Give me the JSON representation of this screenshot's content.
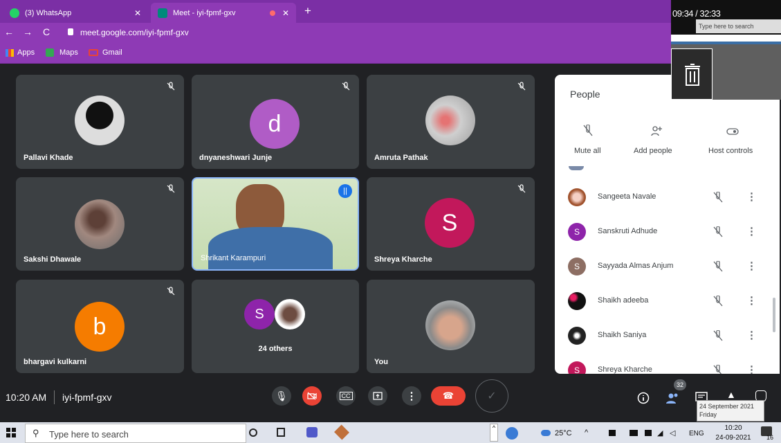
{
  "browser": {
    "tabs": [
      {
        "title": "(3) WhatsApp"
      },
      {
        "title": "Meet - iyi-fpmf-gxv"
      }
    ],
    "url": "meet.google.com/iyi-fpmf-gxv",
    "bookmarks": [
      "Apps",
      "Maps",
      "Gmail"
    ]
  },
  "video_overlay": {
    "time": "09:34 / 32:33",
    "search_placeholder": "Type here to search"
  },
  "tiles": [
    {
      "name": "Pallavi Khade"
    },
    {
      "name": "dnyaneshwari Junje",
      "initial": "d",
      "color": "#b05cc6"
    },
    {
      "name": "Amruta Pathak"
    },
    {
      "name": "Sakshi Dhawale"
    },
    {
      "name": "Shrikant Karampuri"
    },
    {
      "name": "Shreya Kharche",
      "initial": "S",
      "color": "#c2185b"
    },
    {
      "name": "bhargavi kulkarni",
      "initial": "b",
      "color": "#f57c00"
    },
    {
      "name": "24 others",
      "initial": "S",
      "color": "#8e24aa"
    },
    {
      "name": "You"
    }
  ],
  "people_panel": {
    "title": "People",
    "actions": {
      "mute_all": "Mute all",
      "add_people": "Add people",
      "host_controls": "Host controls"
    },
    "participants": [
      {
        "name": "Sangeeta Navale",
        "initial": "",
        "color": "#a0522d"
      },
      {
        "name": "Sanskruti Adhude",
        "initial": "S",
        "color": "#8e24aa"
      },
      {
        "name": "Sayyada Almas Anjum",
        "initial": "S",
        "color": "#8d6e63"
      },
      {
        "name": "Shaikh adeeba",
        "initial": "",
        "color": "#111111"
      },
      {
        "name": "Shaikh Saniya",
        "initial": "",
        "color": "#222222"
      },
      {
        "name": "Shreya Kharche",
        "initial": "S",
        "color": "#c2185b"
      }
    ]
  },
  "meeting_bar": {
    "time": "10:20 AM",
    "code": "iyi-fpmf-gxv",
    "participant_count": "32"
  },
  "taskbar": {
    "search_placeholder": "Type here to search",
    "weather": "25°C",
    "language": "ENG",
    "clock_time": "10:20",
    "clock_date": "24-09-2021",
    "notification_count": "16",
    "tooltip_date": "24 September 2021",
    "tooltip_day": "Friday"
  }
}
